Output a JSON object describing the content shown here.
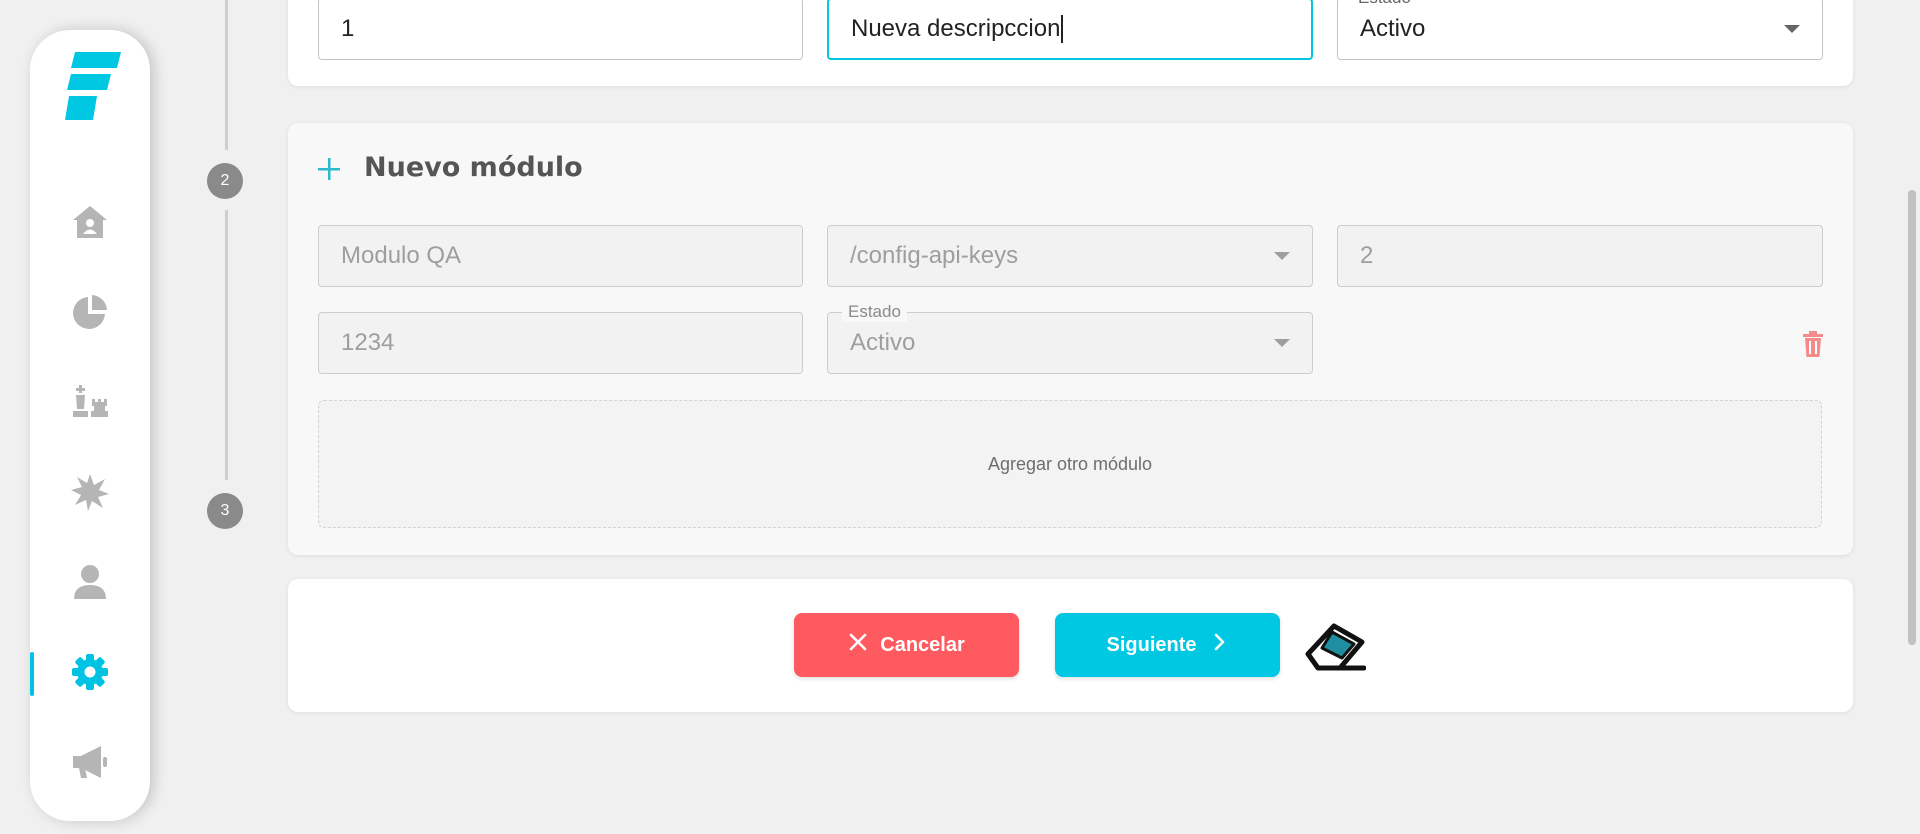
{
  "colors": {
    "accent": "#00c3e3",
    "danger": "#ff5a5f",
    "icon_gray": "#b5b5b5"
  },
  "sidebar": {
    "logo": "brand-logo",
    "items": [
      {
        "icon": "home-icon",
        "active": false
      },
      {
        "icon": "pie-chart-icon",
        "active": false
      },
      {
        "icon": "chess-pieces-icon",
        "active": false
      },
      {
        "icon": "burst-icon",
        "active": false
      },
      {
        "icon": "user-icon",
        "active": false
      },
      {
        "icon": "gear-icon",
        "active": true
      },
      {
        "icon": "megaphone-icon",
        "active": false
      }
    ]
  },
  "stepper": {
    "steps": [
      "2",
      "3"
    ]
  },
  "top_form": {
    "id_value": "1",
    "description_value": "Nueva descripccion",
    "estado_label": "Estado",
    "estado_value": "Activo"
  },
  "module_section": {
    "title": "Nuevo módulo",
    "name_placeholder": "Modulo QA",
    "route_value": "/config-api-keys",
    "order_value": "2",
    "code_value": "1234",
    "estado_label": "Estado",
    "estado_value": "Activo",
    "add_module_label": "Agregar otro módulo"
  },
  "actions": {
    "cancel_label": "Cancelar",
    "next_label": "Siguiente"
  }
}
